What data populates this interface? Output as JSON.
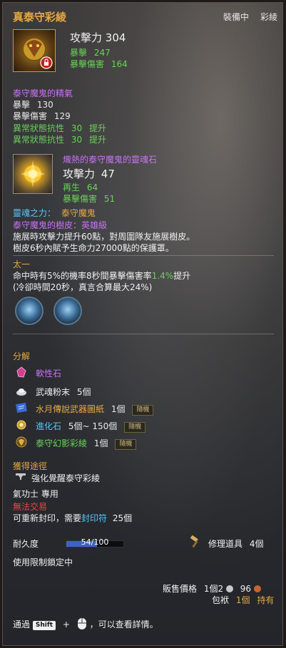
{
  "header": {
    "title": "真泰守彩綾",
    "status": "裝備中",
    "category": "彩綾"
  },
  "main_stats": {
    "attack_label": "攻擊力",
    "attack_value": "304",
    "crit_label": "暴擊",
    "crit_value": "247",
    "crit_dmg_label": "暴擊傷害",
    "crit_dmg_value": "164"
  },
  "spirit": {
    "name": "泰守魔鬼的精氣",
    "lines": [
      {
        "label": "暴擊",
        "value": "130"
      },
      {
        "label": "暴擊傷害",
        "value": "129"
      }
    ],
    "bonus": [
      {
        "label": "異常狀態抗性",
        "value": "30",
        "suffix": "提升"
      },
      {
        "label": "異常狀態抗性",
        "value": "30",
        "suffix": "提升"
      }
    ]
  },
  "gem": {
    "name": "熾熱的泰守魔鬼的靈魂石",
    "attack_label": "攻擊力",
    "attack_value": "47",
    "regen_label": "再生",
    "regen_value": "64",
    "crit_dmg_label": "暴擊傷害",
    "crit_dmg_value": "51"
  },
  "soul": {
    "label": "靈魂之力：",
    "value": "泰守魔鬼",
    "bark_title": "泰守魔鬼的樹皮：英雄級",
    "desc1": "施展時攻擊力提升60點，對周圍隊友施展樹皮。",
    "desc2": "樹皮6秒內賦予生命力27000點的保護罩。"
  },
  "taiyi": {
    "title": "太一",
    "line1_a": "命中時有5%的機率8秒間暴擊傷害率",
    "line1_b": "1.4%",
    "line1_c": "提升",
    "line2": "(冷卻時間20秒，真言合算最大24%)"
  },
  "decompose": {
    "title": "分解",
    "items": [
      {
        "name": "軟性石",
        "qty": "",
        "random": "",
        "icon": "soft-stone-icon",
        "color": "#c873f2"
      },
      {
        "name": "武魂粉末",
        "qty": "5個",
        "random": "",
        "icon": "powder-icon",
        "color": "#f0f0f0"
      },
      {
        "name": "水月傳說武器圖紙",
        "qty": "1個",
        "random": "隨機",
        "icon": "blueprint-icon",
        "color": "#e6a843"
      },
      {
        "name": "進化石",
        "qty": "5個~ 150個",
        "random": "隨機",
        "icon": "evolution-stone-icon",
        "color": "#58c7ff"
      },
      {
        "name": "泰守幻影彩綾",
        "qty": "1個",
        "random": "隨機",
        "icon": "phantom-scarf-icon",
        "color": "#6cd05a"
      }
    ]
  },
  "acquire": {
    "title": "獲得途徑",
    "source": "強化覺醒泰守彩綾",
    "class_line": "氣功士 專用",
    "no_trade": "無法交易",
    "reseal_a": "可重新封印，需要",
    "reseal_item": "封印符",
    "reseal_qty": "25個"
  },
  "durability": {
    "label": "耐久度",
    "current": "54",
    "sep": "/",
    "max": "100",
    "fraction": 0.54,
    "repair_label": "修理道具",
    "repair_qty": "4個"
  },
  "restriction": "使用限制鎖定中",
  "price": {
    "label": "販售價格",
    "unit": "1個",
    "silver": "2",
    "copper": "96",
    "bag_label": "包袱",
    "bag_qty": "1個",
    "owned_label": "持有"
  },
  "footer": {
    "prefix": "通過",
    "key": "Shift",
    "plus": "+",
    "suffix": "，可以查看詳情。"
  },
  "colors": {
    "title": "#e6a843",
    "green": "#6cd05a",
    "purple": "#c873f2",
    "cyan": "#58c7ff",
    "red": "#e84545"
  }
}
